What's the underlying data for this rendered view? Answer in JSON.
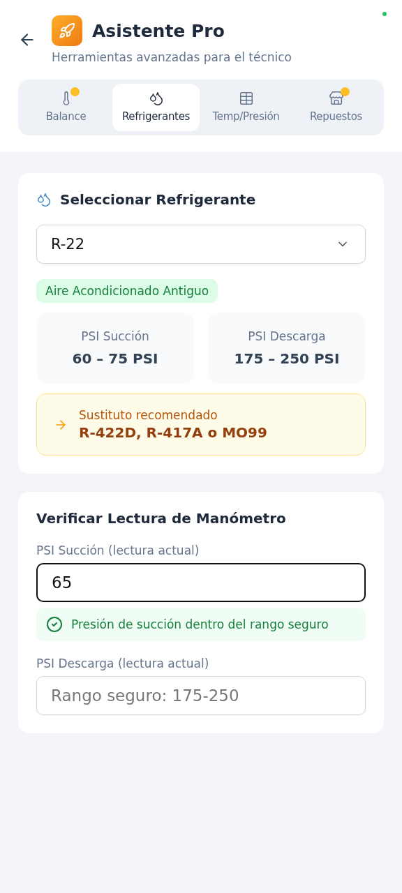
{
  "header": {
    "title": "Asistente Pro",
    "subtitle": "Herramientas avanzadas para el técnico"
  },
  "tabs": [
    {
      "label": "Balance",
      "kind": "thermometer",
      "selected": false,
      "badge": true
    },
    {
      "label": "Refrigerantes",
      "kind": "droplets",
      "selected": true,
      "badge": false
    },
    {
      "label": "Temp/Presión",
      "kind": "table",
      "selected": false,
      "badge": false
    },
    {
      "label": "Repuestos",
      "kind": "store",
      "selected": false,
      "badge": true
    }
  ],
  "refrigerant_card": {
    "title": "Seleccionar Refrigerante",
    "select": {
      "value": "R-22"
    },
    "tag": "Aire Acondicionado Antiguo",
    "ranges": [
      {
        "label": "PSI Succión",
        "value": "60 – 75 PSI"
      },
      {
        "label": "PSI Descarga",
        "value": "175 – 250 PSI"
      }
    ],
    "substitute": {
      "label": "Sustituto recomendado",
      "value": "R-422D, R-417A o MO99"
    }
  },
  "gauge_card": {
    "title": "Verificar Lectura de Manómetro",
    "fields": [
      {
        "label": "PSI Succión (lectura actual)",
        "value": "65",
        "focused": true,
        "message": {
          "kind": "ok",
          "text": "Presión de succión dentro del rango seguro"
        }
      },
      {
        "label": "PSI Descarga (lectura actual)",
        "placeholder": "Rango seguro: 175-250",
        "focused": false
      }
    ]
  }
}
